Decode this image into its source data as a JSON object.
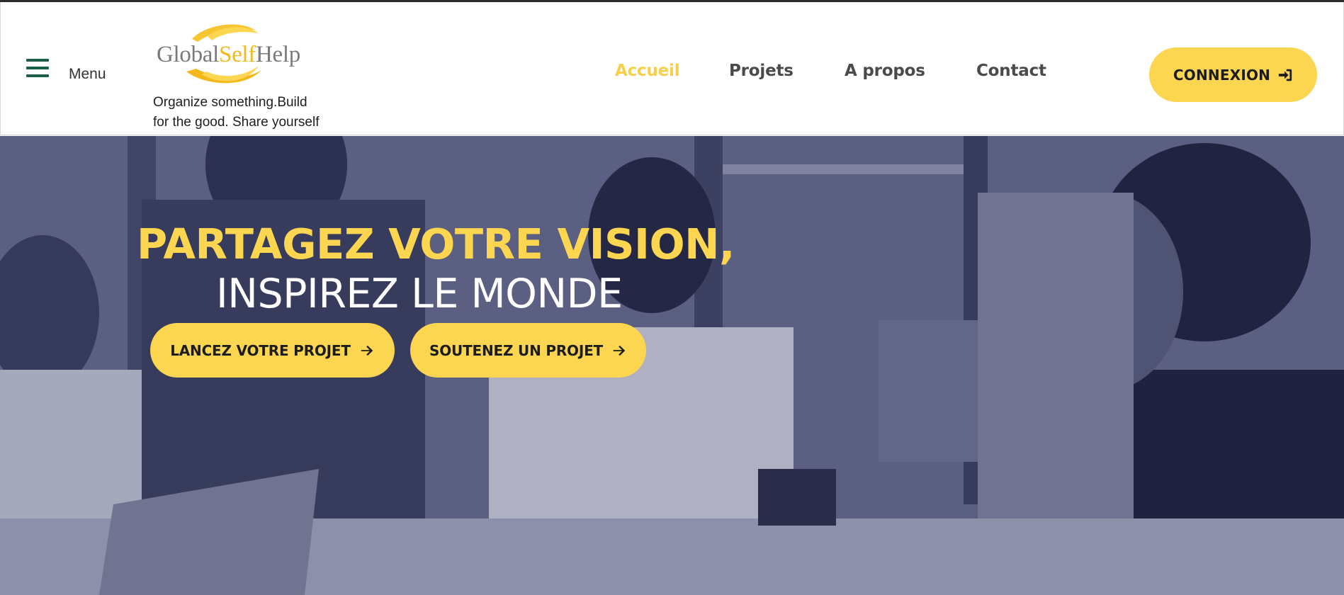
{
  "header": {
    "menu_label": "Menu",
    "logo": {
      "part1": "Global",
      "part2": "Self",
      "part3": "Help"
    },
    "tagline_line1": "Organize something.Build",
    "tagline_line2": "for the good. Share yourself"
  },
  "nav": {
    "items": [
      {
        "label": "Accueil",
        "active": true
      },
      {
        "label": "Projets",
        "active": false
      },
      {
        "label": "A propos",
        "active": false
      },
      {
        "label": "Contact",
        "active": false
      }
    ],
    "login_label": "CONNEXION",
    "login_icon": "sign-in-icon"
  },
  "hero": {
    "title_line1": "PARTAGEZ VOTRE VISION,",
    "title_line2": "INSPIREZ LE MONDE",
    "buttons": [
      {
        "label": "LANCEZ VOTRE PROJET",
        "icon": "arrow-right-icon"
      },
      {
        "label": "SOUTENEZ UN PROJET",
        "icon": "arrow-right-icon"
      }
    ]
  },
  "colors": {
    "accent_yellow": "#fdd651",
    "menu_green": "#1b5e4a",
    "nav_text": "#4a4a4a",
    "hero_overlay": "#6d7291"
  }
}
